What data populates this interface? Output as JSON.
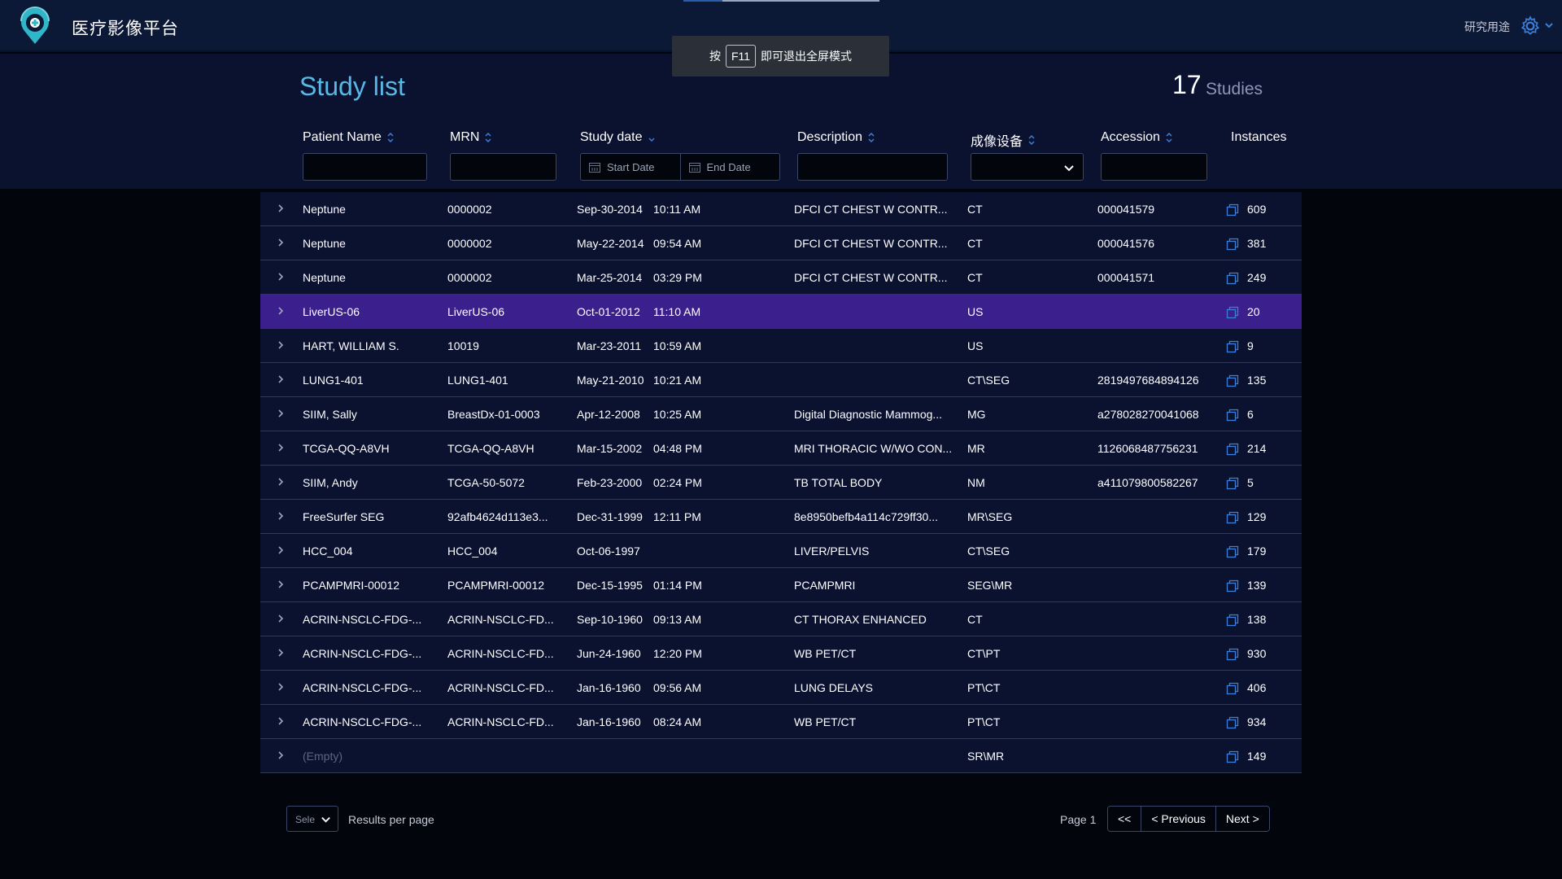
{
  "app": {
    "title": "医疗影像平台",
    "research_label": "研究用途"
  },
  "toast": {
    "prefix": "按",
    "key": "F11",
    "suffix": "即可退出全屏模式"
  },
  "study_list": {
    "title": "Study list",
    "count": "17",
    "count_label": "Studies"
  },
  "columns": {
    "patient_name": "Patient Name",
    "mrn": "MRN",
    "study_date": "Study date",
    "description": "Description",
    "modality": "成像设备",
    "accession": "Accession",
    "instances": "Instances"
  },
  "filters": {
    "start_date": "Start Date",
    "end_date": "End Date"
  },
  "rows": [
    {
      "name": "Neptune",
      "mrn": "0000002",
      "date": "Sep-30-2014",
      "time": "10:11 AM",
      "desc": "DFCI CT CHEST W CONTR...",
      "mod": "CT",
      "acc": "000041579",
      "inst": "609"
    },
    {
      "name": "Neptune",
      "mrn": "0000002",
      "date": "May-22-2014",
      "time": "09:54 AM",
      "desc": "DFCI CT CHEST W CONTR...",
      "mod": "CT",
      "acc": "000041576",
      "inst": "381"
    },
    {
      "name": "Neptune",
      "mrn": "0000002",
      "date": "Mar-25-2014",
      "time": "03:29 PM",
      "desc": "DFCI CT CHEST W CONTR...",
      "mod": "CT",
      "acc": "000041571",
      "inst": "249"
    },
    {
      "name": "LiverUS-06",
      "mrn": "LiverUS-06",
      "date": "Oct-01-2012",
      "time": "11:10 AM",
      "desc": "",
      "mod": "US",
      "acc": "",
      "inst": "20"
    },
    {
      "name": "HART, WILLIAM S.",
      "mrn": "10019",
      "date": "Mar-23-2011",
      "time": "10:59 AM",
      "desc": "",
      "mod": "US",
      "acc": "",
      "inst": "9"
    },
    {
      "name": "LUNG1-401",
      "mrn": "LUNG1-401",
      "date": "May-21-2010",
      "time": "10:21 AM",
      "desc": "",
      "mod": "CT\\SEG",
      "acc": "2819497684894126",
      "inst": "135"
    },
    {
      "name": "SIIM, Sally",
      "mrn": "BreastDx-01-0003",
      "date": "Apr-12-2008",
      "time": "10:25 AM",
      "desc": "Digital Diagnostic Mammog...",
      "mod": "MG",
      "acc": "a278028270041068",
      "inst": "6"
    },
    {
      "name": "TCGA-QQ-A8VH",
      "mrn": "TCGA-QQ-A8VH",
      "date": "Mar-15-2002",
      "time": "04:48 PM",
      "desc": "MRI THORACIC W/WO CON...",
      "mod": "MR",
      "acc": "1126068487756231",
      "inst": "214"
    },
    {
      "name": "SIIM, Andy",
      "mrn": "TCGA-50-5072",
      "date": "Feb-23-2000",
      "time": "02:24 PM",
      "desc": "TB TOTAL BODY",
      "mod": "NM",
      "acc": "a411079800582267",
      "inst": "5"
    },
    {
      "name": "FreeSurfer SEG",
      "mrn": "92afb4624d113e3...",
      "date": "Dec-31-1999",
      "time": "12:11 PM",
      "desc": "8e8950befb4a114c729ff30...",
      "mod": "MR\\SEG",
      "acc": "",
      "inst": "129"
    },
    {
      "name": "HCC_004",
      "mrn": "HCC_004",
      "date": "Oct-06-1997",
      "time": "",
      "desc": "LIVER/PELVIS",
      "mod": "CT\\SEG",
      "acc": "",
      "inst": "179"
    },
    {
      "name": "PCAMPMRI-00012",
      "mrn": "PCAMPMRI-00012",
      "date": "Dec-15-1995",
      "time": "01:14 PM",
      "desc": "PCAMPMRI",
      "mod": "SEG\\MR",
      "acc": "",
      "inst": "139"
    },
    {
      "name": "ACRIN-NSCLC-FDG-...",
      "mrn": "ACRIN-NSCLC-FD...",
      "date": "Sep-10-1960",
      "time": "09:13 AM",
      "desc": "CT THORAX ENHANCED",
      "mod": "CT",
      "acc": "",
      "inst": "138"
    },
    {
      "name": "ACRIN-NSCLC-FDG-...",
      "mrn": "ACRIN-NSCLC-FD...",
      "date": "Jun-24-1960",
      "time": "12:20 PM",
      "desc": "WB PET/CT",
      "mod": "CT\\PT",
      "acc": "",
      "inst": "930"
    },
    {
      "name": "ACRIN-NSCLC-FDG-...",
      "mrn": "ACRIN-NSCLC-FD...",
      "date": "Jan-16-1960",
      "time": "09:56 AM",
      "desc": "LUNG DELAYS",
      "mod": "PT\\CT",
      "acc": "",
      "inst": "406"
    },
    {
      "name": "ACRIN-NSCLC-FDG-...",
      "mrn": "ACRIN-NSCLC-FD...",
      "date": "Jan-16-1960",
      "time": "08:24 AM",
      "desc": "WB PET/CT",
      "mod": "PT\\CT",
      "acc": "",
      "inst": "934"
    },
    {
      "name": "(Empty)",
      "mrn": "",
      "date": "",
      "time": "",
      "desc": "",
      "mod": "SR\\MR",
      "acc": "",
      "inst": "149"
    }
  ],
  "selected_row_index": 3,
  "footer": {
    "per_page_value": "Sele",
    "per_page_label": "Results per page",
    "page_label": "Page 1",
    "first_label": "<<",
    "prev_label": "< Previous",
    "next_label": "Next >"
  },
  "colors": {
    "accent": "#59b9e6",
    "header_bg": "#0b1836",
    "table_bg": "#0b1230",
    "selected_row": "#3b1f8c",
    "border": "#2d3a5e"
  }
}
